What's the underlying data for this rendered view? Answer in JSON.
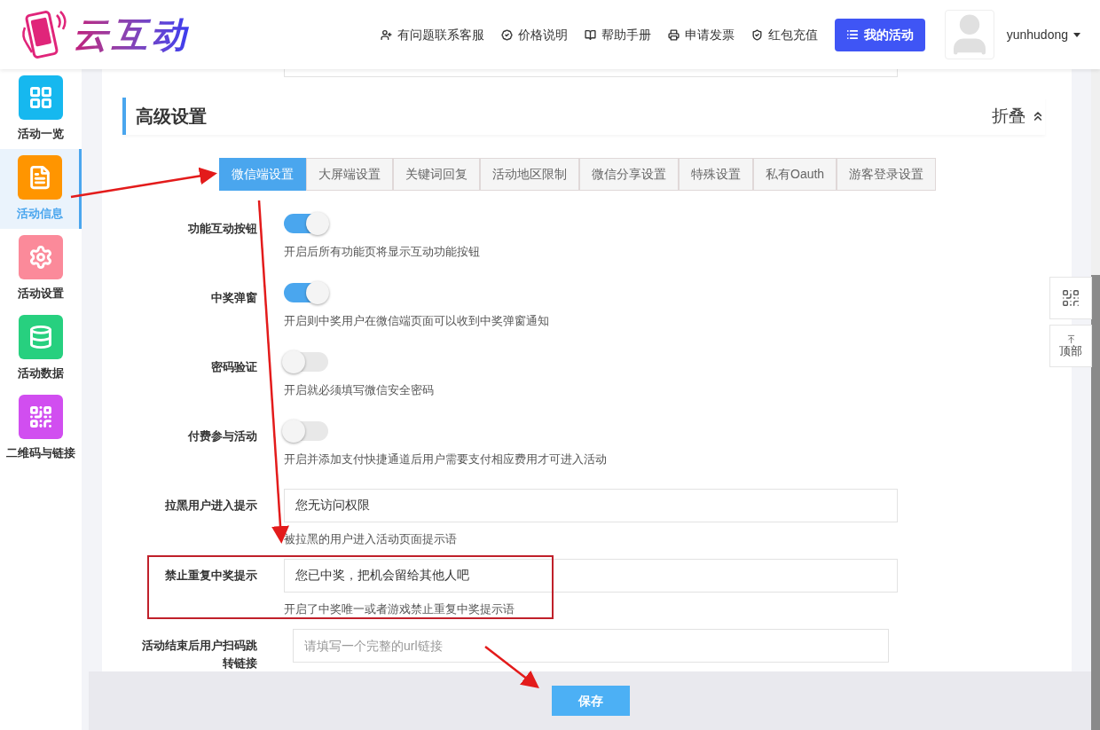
{
  "header": {
    "logo_text": "云互动",
    "nav": [
      {
        "label": "有问题联系客服"
      },
      {
        "label": "价格说明"
      },
      {
        "label": "帮助手册"
      },
      {
        "label": "申请发票"
      },
      {
        "label": "红包充值"
      }
    ],
    "primary_button": "我的活动",
    "username": "yunhudong"
  },
  "sidebar": {
    "items": [
      {
        "label": "活动一览",
        "color": "#16b8ef",
        "selected": false
      },
      {
        "label": "活动信息",
        "color": "#ff9500",
        "selected": true
      },
      {
        "label": "活动设置",
        "color": "#fb8a9a",
        "selected": false
      },
      {
        "label": "活动数据",
        "color": "#27d07f",
        "selected": false
      },
      {
        "label": "二维码与链接",
        "color": "#d14ef0",
        "selected": false
      }
    ]
  },
  "section": {
    "title": "高级设置",
    "collapse_label": "折叠"
  },
  "tabs": [
    {
      "label": "微信端设置",
      "selected": true
    },
    {
      "label": "大屏端设置",
      "selected": false
    },
    {
      "label": "关键词回复",
      "selected": false
    },
    {
      "label": "活动地区限制",
      "selected": false
    },
    {
      "label": "微信分享设置",
      "selected": false
    },
    {
      "label": "特殊设置",
      "selected": false
    },
    {
      "label": "私有Oauth",
      "selected": false
    },
    {
      "label": "游客登录设置",
      "selected": false
    }
  ],
  "fields": [
    {
      "kind": "toggle",
      "label": "功能互动按钮",
      "on": true,
      "hint": "开启后所有功能页将显示互动功能按钮"
    },
    {
      "kind": "toggle",
      "label": "中奖弹窗",
      "on": true,
      "hint": "开启则中奖用户在微信端页面可以收到中奖弹窗通知"
    },
    {
      "kind": "toggle",
      "label": "密码验证",
      "on": false,
      "hint": "开启就必须填写微信安全密码"
    },
    {
      "kind": "toggle",
      "label": "付费参与活动",
      "on": false,
      "hint": "开启并添加支付快捷通道后用户需要支付相应费用才可进入活动"
    },
    {
      "kind": "text",
      "label": "拉黑用户进入提示",
      "value": "您无访问权限",
      "hint": "被拉黑的用户进入活动页面提示语"
    },
    {
      "kind": "text",
      "label": "禁止重复中奖提示",
      "value": "您已中奖，把机会留给其他人吧",
      "hint": "开启了中奖唯一或者游戏禁止重复中奖提示语",
      "highlighted": true
    },
    {
      "kind": "text",
      "label": "活动结束后用户扫码跳转链接",
      "placeholder": "请填写一个完整的url链接"
    }
  ],
  "footer": {
    "save_button": "保存"
  },
  "float_tools": {
    "top_label": "顶部"
  }
}
